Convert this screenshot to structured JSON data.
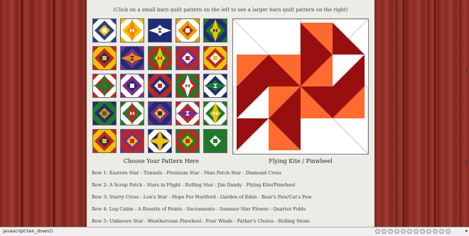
{
  "instruction": "(Click on a small barn quilt pattern on the left to see a larger barn quilt pattern on the right)",
  "left_caption": "Choose Your Pattern Here",
  "right_caption": "Flying Kite / Pinwheel",
  "tiles": [
    {
      "name": "eastern-star",
      "c": [
        "#2b3e8c",
        "#f2c200",
        "#ffffff"
      ]
    },
    {
      "name": "tunnels",
      "c": [
        "#f2c200",
        "#f28a00",
        "#ffffff"
      ]
    },
    {
      "name": "premium-star",
      "c": [
        "#1c2d7a",
        "#ffffff",
        "#1c2d7a"
      ]
    },
    {
      "name": "nine-patch-star",
      "c": [
        "#e6a400",
        "#c0271f",
        "#ffffff"
      ]
    },
    {
      "name": "diamond-cross",
      "c": [
        "#1f7a2a",
        "#f2c200",
        "#1c2d7a"
      ]
    },
    {
      "name": "a-scrap-patch",
      "c": [
        "#c0271f",
        "#1c2d7a",
        "#f2c200"
      ]
    },
    {
      "name": "stars-in-flight",
      "c": [
        "#7a2d8a",
        "#f28a00",
        "#1c2d7a"
      ]
    },
    {
      "name": "rolling-star",
      "c": [
        "#1f7a2a",
        "#f2c200",
        "#c0271f"
      ]
    },
    {
      "name": "jim-dandy",
      "c": [
        "#7a2d8a",
        "#ffffff",
        "#c0271f"
      ]
    },
    {
      "name": "flying-kite-pinwheel",
      "c": [
        "#c0271f",
        "#ffffff",
        "#f2c200"
      ]
    },
    {
      "name": "starry-cross",
      "c": [
        "#c0271f",
        "#1f7a2a",
        "#ffffff"
      ]
    },
    {
      "name": "lons-star",
      "c": [
        "#7a2d8a",
        "#1c2d7a",
        "#ffffff"
      ]
    },
    {
      "name": "hope-for-hartford",
      "c": [
        "#1c2d7a",
        "#ffffff",
        "#c0271f"
      ]
    },
    {
      "name": "garden-of-eden",
      "c": [
        "#c0271f",
        "#ffffff",
        "#1f7a2a"
      ]
    },
    {
      "name": "bears-paw-cats-paw",
      "c": [
        "#1c2d7a",
        "#1f7a2a",
        "#ffffff"
      ]
    },
    {
      "name": "log-cabin",
      "c": [
        "#1c2d7a",
        "#f28a00",
        "#1f7a2a"
      ]
    },
    {
      "name": "a-rosette-of-points",
      "c": [
        "#1f7a2a",
        "#c0271f",
        "#ffffff"
      ]
    },
    {
      "name": "sacramento",
      "c": [
        "#7a2d8a",
        "#f2c200",
        "#1c2d7a"
      ]
    },
    {
      "name": "summer-star-flower",
      "c": [
        "#c0271f",
        "#7a2d8a",
        "#ffffff"
      ]
    },
    {
      "name": "quarter-folds",
      "c": [
        "#1f7a2a",
        "#f2c200",
        "#ffffff"
      ]
    },
    {
      "name": "unknown-star",
      "c": [
        "#c0271f",
        "#1c2d7a",
        "#f2c200"
      ]
    },
    {
      "name": "weathervane-pinwheel",
      "c": [
        "#7a2d8a",
        "#f2c200",
        "#c0271f"
      ]
    },
    {
      "name": "four-winds",
      "c": [
        "#1c2d7a",
        "#f2c200",
        "#ffffff"
      ]
    },
    {
      "name": "fathers-choice",
      "c": [
        "#1f7a2a",
        "#f2c200",
        "#c0271f"
      ]
    },
    {
      "name": "rolling-stone",
      "c": [
        "#1f7a2a",
        "#ffffff",
        "#1f7a2a"
      ]
    }
  ],
  "rows": [
    {
      "label": "Row 1:",
      "items": [
        "Eastern Star",
        "Tunnels",
        "Premium Star",
        "Nine Patch Star",
        "Diamond Cross"
      ]
    },
    {
      "label": "Row 2:",
      "items": [
        "A Scrap Patch",
        "Stars in Flight",
        "Rolling Star",
        "Jim Dandy",
        "Flying Kite/Pinwheel"
      ]
    },
    {
      "label": "Row 3:",
      "items": [
        "Starry Cross",
        "Lon's Star",
        "Hope For Hartford",
        "Garden of Eden",
        "Bear's Paw/Cat's Paw"
      ]
    },
    {
      "label": "Row 4:",
      "items": [
        "Log Cabin",
        "A Rosette of Points",
        "Sacramento",
        "Summer Star Flower",
        "Quarter Folds"
      ]
    },
    {
      "label": "Row 5:",
      "items": [
        "Unknown Star",
        "Weathervane Pinwheel",
        "Four Winds",
        "Father's Choice",
        "Rolling Stone"
      ]
    }
  ],
  "status": {
    "text": "javascript:ten_down()",
    "zoom": "▾"
  },
  "colors": {
    "barn_red": "#8d2c25",
    "panel": "#ecece6",
    "kite_dark": "#990f0f",
    "kite_orange": "#ff6a2e"
  }
}
